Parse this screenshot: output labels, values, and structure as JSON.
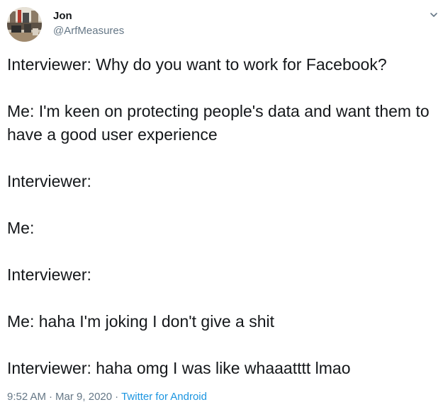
{
  "author": {
    "name": "Jon",
    "handle": "@ArfMeasures"
  },
  "tweet": {
    "paragraphs": [
      "Interviewer: Why do you want to work for Facebook?",
      "Me: I'm keen on protecting people's data and want them to have a good user experience",
      "Interviewer:",
      "Me:",
      "Interviewer:",
      "Me: haha I'm joking I don't give a shit",
      "Interviewer: haha omg I was like whaaatttt lmao"
    ]
  },
  "meta": {
    "time": "9:52 AM",
    "separator": "·",
    "date": "Mar 9, 2020",
    "source": "Twitter for Android"
  },
  "icons": {
    "menu": "chevron-down-icon"
  },
  "colors": {
    "text": "#14171a",
    "secondary": "#657786",
    "link": "#1b95e0"
  }
}
